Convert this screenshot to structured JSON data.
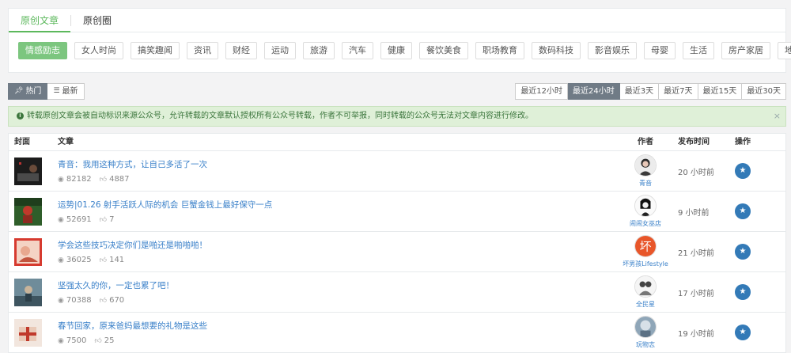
{
  "tabs": [
    {
      "label": "原创文章",
      "active": true
    },
    {
      "label": "原创圈",
      "active": false
    }
  ],
  "categories": [
    "情感励志",
    "女人时尚",
    "搞笑趣闻",
    "资讯",
    "财经",
    "运动",
    "旅游",
    "汽车",
    "健康",
    "餐饮美食",
    "职场教育",
    "数码科技",
    "影音娱乐",
    "母婴",
    "生活",
    "房产家居",
    "地方"
  ],
  "active_category": "情感励志",
  "sort": {
    "hot_label": "热门",
    "new_label": "最新",
    "active": "hot"
  },
  "ranges": [
    "最近12小时",
    "最近24小时",
    "最近3天",
    "最近7天",
    "最近15天",
    "最近30天"
  ],
  "active_range": "最近24小时",
  "alert": {
    "text": "转载原创文章会被自动标识来源公众号，允许转载的文章默认授权所有公众号转载，作者不可举报，同时转载的公众号无法对文章内容进行修改。",
    "close": "×"
  },
  "table": {
    "headers": {
      "cover": "封面",
      "article": "文章",
      "author": "作者",
      "time": "发布时间",
      "action": "操作"
    },
    "rows": [
      {
        "title": "青音：我用这种方式，让自己多活了一次",
        "views": "82182",
        "likes": "4887",
        "author": "青音",
        "time": "20 小时前"
      },
      {
        "title": "运势|01.26 射手活跃人际的机会 巨蟹金钱上最好保守一点",
        "views": "52691",
        "likes": "7",
        "author": "闹闹女巫店",
        "time": "9 小时前"
      },
      {
        "title": "学会这些技巧决定你们是啪还是啪啪啪！",
        "views": "36025",
        "likes": "141",
        "author": "坏男孩Lifestyle",
        "time": "21 小时前"
      },
      {
        "title": "坚强太久的你，一定也累了吧！",
        "views": "70388",
        "likes": "670",
        "author": "全民星",
        "time": "17 小时前"
      },
      {
        "title": "春节回家，原来爸妈最想要的礼物是这些",
        "views": "7500",
        "likes": "25",
        "author": "玩物志",
        "time": "19 小时前"
      }
    ]
  },
  "colors": {
    "accent": "#5cb85c",
    "link": "#3a80c9",
    "alert_bg": "#dff0d8",
    "star": "#337ab7"
  }
}
